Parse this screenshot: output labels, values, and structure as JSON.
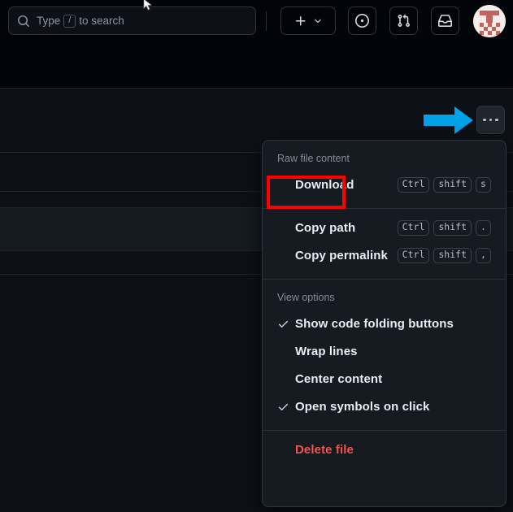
{
  "header": {
    "search": {
      "icon": "search-icon",
      "placeholder_before": "Type",
      "key_hint": "/",
      "placeholder_after": "to search",
      "value": ""
    },
    "actions": [
      {
        "name": "create-new-button",
        "icon": "plus-icon",
        "label": "",
        "has_chevron": true
      },
      {
        "name": "issues-button",
        "icon": "issue-opened-icon",
        "label": ""
      },
      {
        "name": "pull-requests-button",
        "icon": "git-pull-request-icon",
        "label": ""
      },
      {
        "name": "notifications-inbox-button",
        "icon": "inbox-icon",
        "label": ""
      }
    ],
    "avatar": {
      "name": "user-avatar",
      "alt": "User avatar"
    }
  },
  "toolbar": {
    "more_options_label": "More file actions",
    "more_options_icon": "kebab-horizontal-icon"
  },
  "annotations": {
    "arrow": {
      "name": "blue-arrow-annotation",
      "color": "#00a2e8",
      "direction": "right",
      "points_to": "more-options-button"
    },
    "highlight": {
      "name": "red-highlight-box",
      "color": "#fe0000",
      "targets": "download-menu-item"
    }
  },
  "menu": {
    "sections": [
      {
        "header": "Raw file content",
        "items": [
          {
            "label": "Download",
            "keys": [
              "Ctrl",
              "shift",
              "s"
            ],
            "checked": false,
            "danger": false
          }
        ]
      },
      {
        "header": "",
        "items": [
          {
            "label": "Copy path",
            "keys": [
              "Ctrl",
              "shift",
              "."
            ],
            "checked": false,
            "danger": false
          },
          {
            "label": "Copy permalink",
            "keys": [
              "Ctrl",
              "shift",
              ","
            ],
            "checked": false,
            "danger": false
          }
        ]
      },
      {
        "header": "View options",
        "items": [
          {
            "label": "Show code folding buttons",
            "keys": [],
            "checked": true,
            "danger": false
          },
          {
            "label": "Wrap lines",
            "keys": [],
            "checked": false,
            "danger": false
          },
          {
            "label": "Center content",
            "keys": [],
            "checked": false,
            "danger": false
          },
          {
            "label": "Open symbols on click",
            "keys": [],
            "checked": true,
            "danger": false
          }
        ]
      },
      {
        "header": "",
        "items": [
          {
            "label": "Delete file",
            "keys": [],
            "checked": false,
            "danger": true
          }
        ]
      }
    ]
  },
  "background": {
    "rows": [
      108,
      187,
      235,
      255,
      308,
      337
    ]
  },
  "colors": {
    "page_bg": "#0d1117",
    "header_bg": "#010409",
    "menu_bg": "#161b22",
    "border": "#30363d",
    "text": "#e6edf3",
    "muted": "#818d99",
    "danger": "#f85149",
    "annotation_blue": "#00a2e8",
    "annotation_red": "#fe0000"
  }
}
